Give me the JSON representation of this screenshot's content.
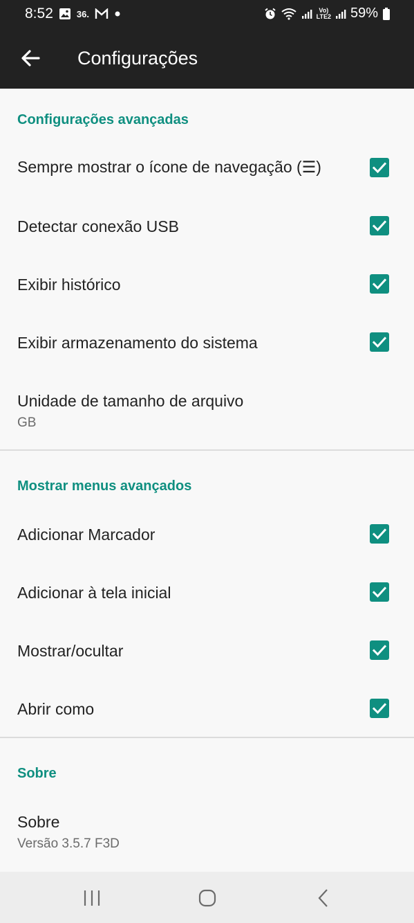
{
  "status_bar": {
    "time": "8:52",
    "notification_badge": "36.",
    "battery": "59%",
    "volte": "Vo)",
    "lte": "LTE2",
    "icons": [
      "image-icon",
      "gmail-icon",
      "dot-icon",
      "alarm-icon",
      "wifi-icon",
      "signal-icon",
      "volte-icon",
      "signal-icon-2",
      "battery-icon"
    ]
  },
  "app_bar": {
    "title": "Configurações",
    "back_icon": "arrow-left-icon"
  },
  "sections": [
    {
      "header": "Configurações avançadas",
      "items": [
        {
          "label": "Sempre mostrar o ícone de navegação (☰)",
          "checked": true
        },
        {
          "label": "Detectar conexão USB",
          "checked": true
        },
        {
          "label": "Exibir histórico",
          "checked": true
        },
        {
          "label": "Exibir armazenamento do sistema",
          "checked": true
        },
        {
          "label": "Unidade de tamanho de arquivo",
          "value": "GB"
        }
      ]
    },
    {
      "header": "Mostrar menus avançados",
      "items": [
        {
          "label": "Adicionar Marcador",
          "checked": true
        },
        {
          "label": "Adicionar à tela inicial",
          "checked": true
        },
        {
          "label": "Mostrar/ocultar",
          "checked": true
        },
        {
          "label": "Abrir como",
          "checked": true
        }
      ]
    },
    {
      "header": "Sobre",
      "items": [
        {
          "label": "Sobre",
          "value": "Versão 3.5.7 F3D"
        }
      ]
    }
  ],
  "nav_bar": {
    "icons": [
      "recents-icon",
      "home-icon",
      "back-icon"
    ]
  },
  "colors": {
    "accent": "#0f8f80",
    "bar_background": "#222222",
    "page_background": "#f8f8f8",
    "navbar_background": "#ededed"
  }
}
